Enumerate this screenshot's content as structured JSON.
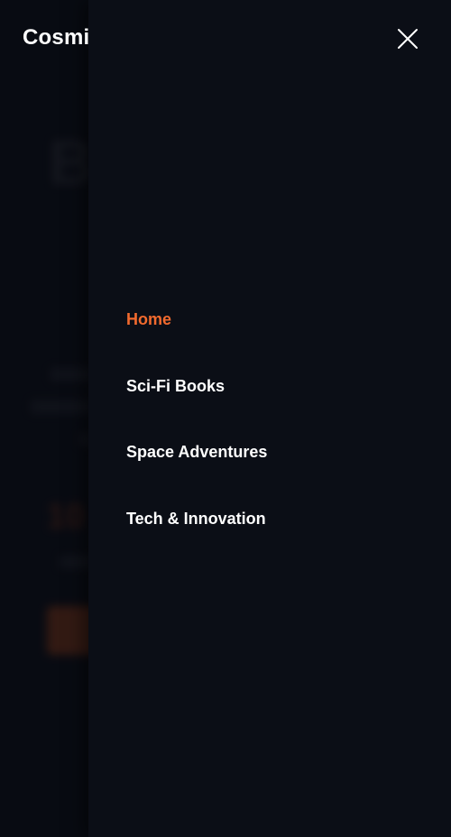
{
  "header": {
    "brand": "Cosmi",
    "close_icon": "close-icon"
  },
  "background": {
    "hero_title": "B",
    "stat": "10"
  },
  "nav": {
    "items": [
      {
        "label": "Home",
        "active": true
      },
      {
        "label": "Sci-Fi Books",
        "active": false
      },
      {
        "label": "Space Adventures",
        "active": false
      },
      {
        "label": "Tech & Innovation",
        "active": false
      }
    ]
  },
  "colors": {
    "accent": "#f26a2e",
    "background": "#0b0e16",
    "text": "#ffffff"
  }
}
